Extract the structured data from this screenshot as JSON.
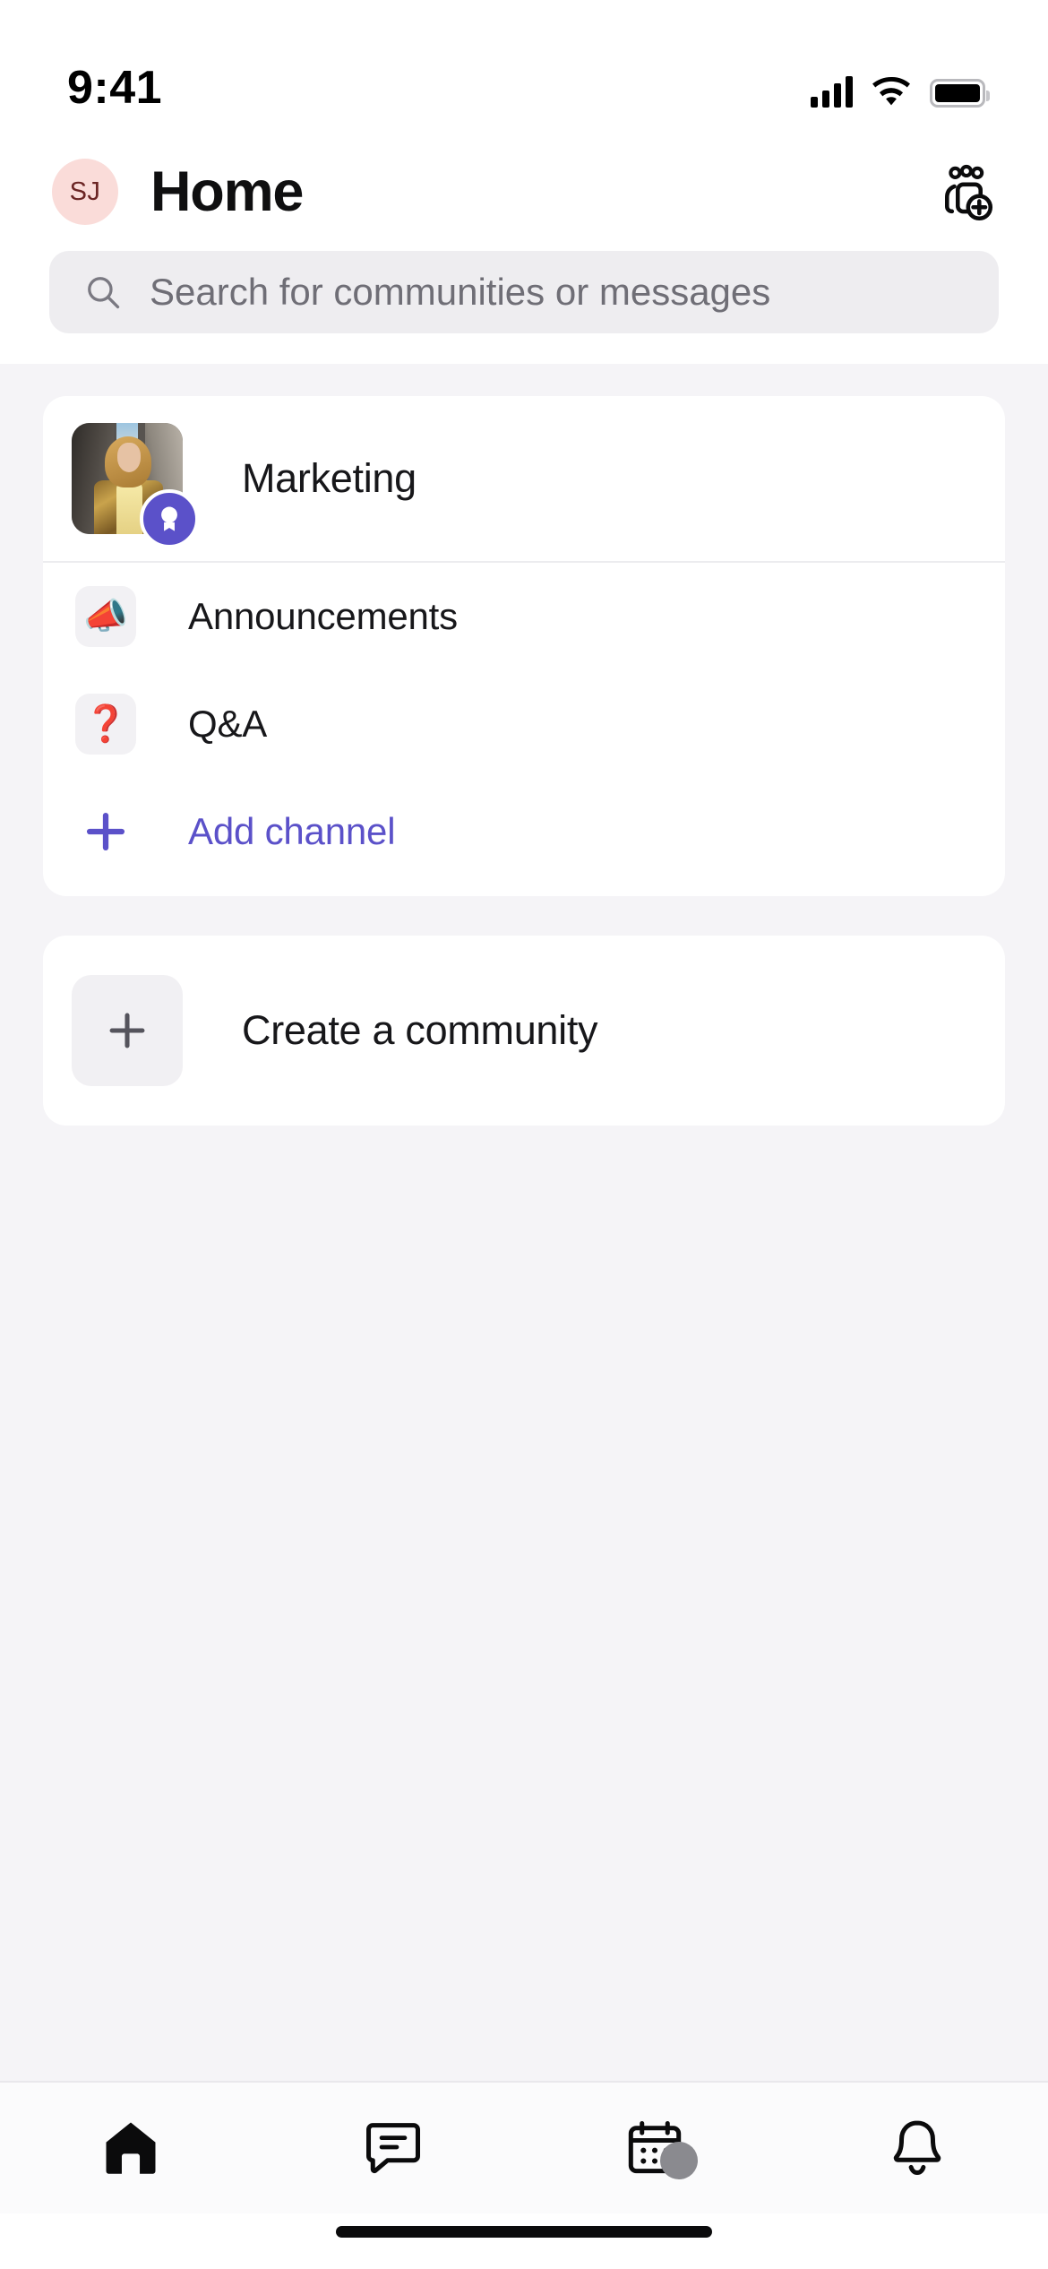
{
  "status_bar": {
    "time": "9:41",
    "cellular_icon": "cellular-bars-icon",
    "wifi_icon": "wifi-icon",
    "battery_icon": "battery-full-icon"
  },
  "header": {
    "avatar_initials": "SJ",
    "avatar_bg_color": "#fadcd9",
    "avatar_text_color": "#6b2524",
    "title": "Home",
    "action_icon": "add-people-icon"
  },
  "search": {
    "icon": "search-icon",
    "placeholder": "Search for communities or messages",
    "value": "",
    "bg_color": "#eeedf0"
  },
  "community_card": {
    "name": "Marketing",
    "thumbnail_alt": "marketing-community-photo",
    "badge_icon": "award-badge-icon",
    "badge_color": "#5b51c9",
    "channels": [
      {
        "icon": "megaphone-emoji",
        "glyph": "📣",
        "label": "Announcements"
      },
      {
        "icon": "question-mark-emoji",
        "glyph": "❓",
        "label": "Q&A"
      }
    ],
    "add_channel": {
      "icon": "plus-icon",
      "label": "Add channel",
      "color": "#5b51c9"
    }
  },
  "create_card": {
    "icon": "plus-icon",
    "label": "Create a community"
  },
  "tab_bar": {
    "tabs": [
      {
        "name": "home",
        "icon": "home-icon",
        "active": true
      },
      {
        "name": "chat",
        "icon": "chat-bubble-icon",
        "active": false
      },
      {
        "name": "calendar",
        "icon": "calendar-icon",
        "active": false
      },
      {
        "name": "notifications",
        "icon": "bell-icon",
        "active": false
      }
    ]
  },
  "home_indicator": {
    "name": "home-indicator"
  }
}
